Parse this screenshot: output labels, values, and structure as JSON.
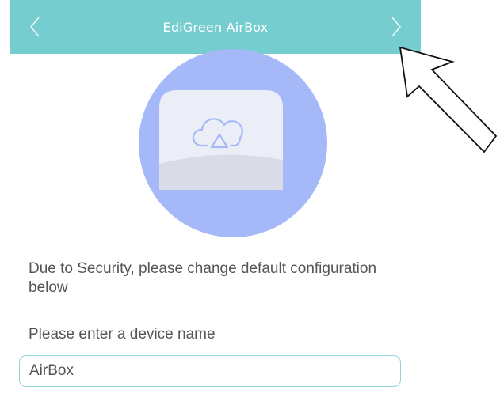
{
  "header": {
    "title": "EdiGreen AirBox",
    "back_icon": "chevron-left-icon",
    "next_icon": "chevron-right-icon",
    "background": "#76cdd0"
  },
  "hero": {
    "icon": "cloud-device-illustration",
    "circle_color": "#a5b9f8"
  },
  "form": {
    "message": "Due to Security, please change default configuration below",
    "device_name_label": "Please enter a device name",
    "device_name_value": "AirBox",
    "accent_color": "#8fd5d9"
  }
}
